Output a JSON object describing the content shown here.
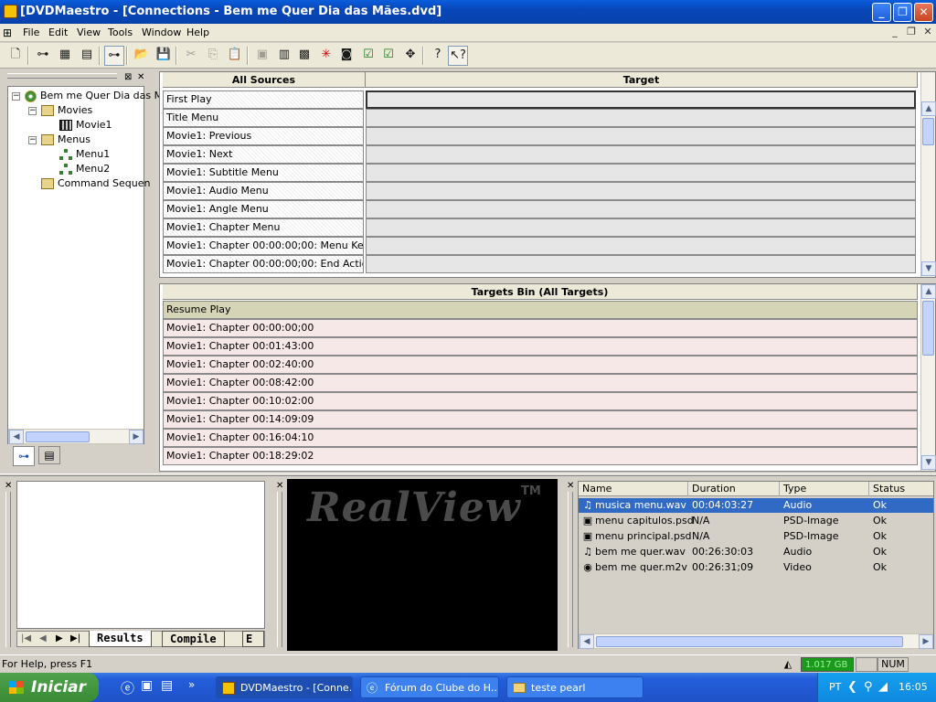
{
  "window": {
    "title": "[DVDMaestro - [Connections - Bem me Quer Dia das Mães.dvd]"
  },
  "menu": [
    "File",
    "Edit",
    "View",
    "Tools",
    "Window",
    "Help"
  ],
  "tree": {
    "root": "Bem me Quer Dia das M",
    "movies": "Movies",
    "movie1": "Movie1",
    "menus": "Menus",
    "menu1": "Menu1",
    "menu2": "Menu2",
    "command": "Command Sequen"
  },
  "connections": {
    "sources_header": "All Sources",
    "target_header": "Target",
    "sources": [
      "First Play",
      "Title Menu",
      "Movie1: Previous",
      "Movie1: Next",
      "Movie1: Subtitle Menu",
      "Movie1: Audio Menu",
      "Movie1: Angle Menu",
      "Movie1: Chapter Menu",
      "Movie1: Chapter 00:00:00;00: Menu Key",
      "Movie1: Chapter 00:00:00;00: End Action"
    ]
  },
  "targets_bin": {
    "header": "Targets Bin (All Targets)",
    "items": [
      "Resume Play",
      "Movie1: Chapter 00:00:00;00",
      "Movie1: Chapter 00:01:43:00",
      "Movie1: Chapter 00:02:40:00",
      "Movie1: Chapter 00:08:42:00",
      "Movie1: Chapter 00:10:02:00",
      "Movie1: Chapter 00:14:09:09",
      "Movie1: Chapter 00:16:04:10",
      "Movie1: Chapter 00:18:29:02"
    ]
  },
  "output_tabs": {
    "results": "Results",
    "compile": "Compile",
    "more": "E"
  },
  "preview": {
    "brand": "RealView",
    "tm": "TM"
  },
  "assets": {
    "columns": [
      "Name",
      "Duration",
      "Type",
      "Status"
    ],
    "rows": [
      {
        "name": "musica menu.wav",
        "duration": "00:04:03:27",
        "type": "Audio",
        "status": "Ok",
        "icon": "audio-icon"
      },
      {
        "name": "menu capitulos.psd",
        "duration": "N/A",
        "type": "PSD-Image",
        "status": "Ok",
        "icon": "image-icon"
      },
      {
        "name": "menu principal.psd",
        "duration": "N/A",
        "type": "PSD-Image",
        "status": "Ok",
        "icon": "image-icon"
      },
      {
        "name": "bem me quer.wav",
        "duration": "00:26:30:03",
        "type": "Audio",
        "status": "Ok",
        "icon": "audio-icon"
      },
      {
        "name": "bem me quer.m2v",
        "duration": "00:26:31;09",
        "type": "Video",
        "status": "Ok",
        "icon": "video-icon"
      }
    ]
  },
  "status": {
    "help": "For Help, press F1",
    "disk": "1.017 GB",
    "num": "NUM"
  },
  "taskbar": {
    "start": "Iniciar",
    "tasks": [
      "DVDMaestro - [Conne...",
      "Fórum do Clube do H...",
      "teste pearl"
    ],
    "lang": "PT",
    "clock": "16:05"
  },
  "colors": {
    "title_blue": "#0a5ddc",
    "selection": "#316ac5",
    "disk_green": "#1a9a1a"
  }
}
